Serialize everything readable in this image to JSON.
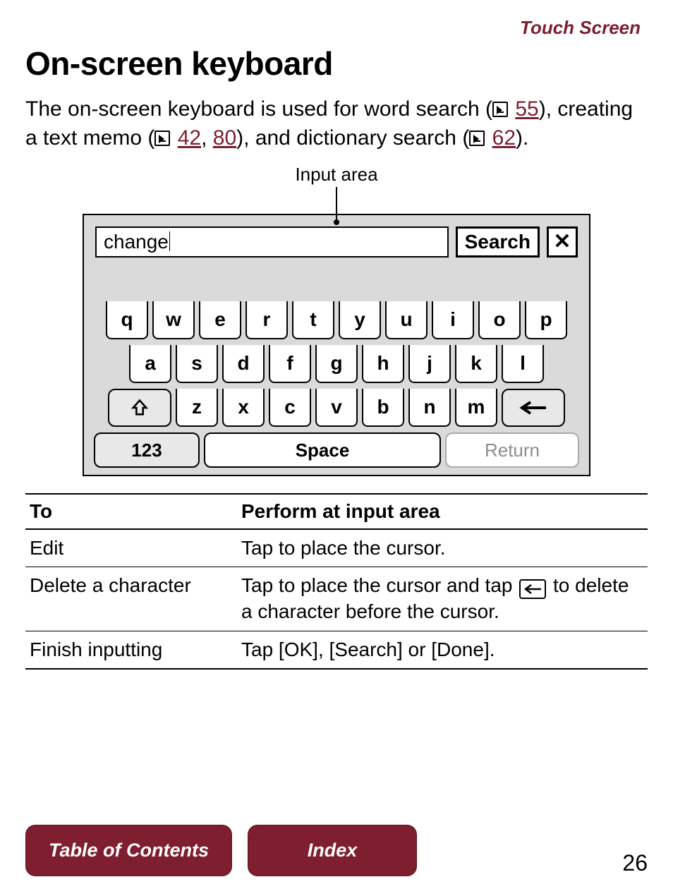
{
  "section_label": "Touch Screen",
  "title": "On-screen keyboard",
  "intro": {
    "pre": "The on-screen keyboard is used for word search (",
    "link1": "55",
    "mid1": "), creating a text memo (",
    "link2": "42",
    "sep": ", ",
    "link3": "80",
    "mid2": "), and dictionary search (",
    "link4": "62",
    "post": ")."
  },
  "callout": "Input area",
  "keyboard": {
    "input_value": "change",
    "search_label": "Search",
    "close_label": "✕",
    "row1": [
      "q",
      "w",
      "e",
      "r",
      "t",
      "y",
      "u",
      "i",
      "o",
      "p"
    ],
    "row2": [
      "a",
      "s",
      "d",
      "f",
      "g",
      "h",
      "j",
      "k",
      "l"
    ],
    "row3": [
      "z",
      "x",
      "c",
      "v",
      "b",
      "n",
      "m"
    ],
    "mode_key": "123",
    "space_key": "Space",
    "return_key": "Return"
  },
  "table": {
    "head": {
      "c1": "To",
      "c2": "Perform at input area"
    },
    "rows": [
      {
        "c1": "Edit",
        "c2": "Tap to place the cursor."
      },
      {
        "c1": "Delete a character",
        "c2_pre": "Tap to place the cursor and tap ",
        "c2_post": " to delete a character before the cursor."
      },
      {
        "c1": "Finish inputting",
        "c2": "Tap [OK], [Search] or [Done]."
      }
    ]
  },
  "footer": {
    "toc": "Table of Contents",
    "index": "Index",
    "page": "26"
  }
}
